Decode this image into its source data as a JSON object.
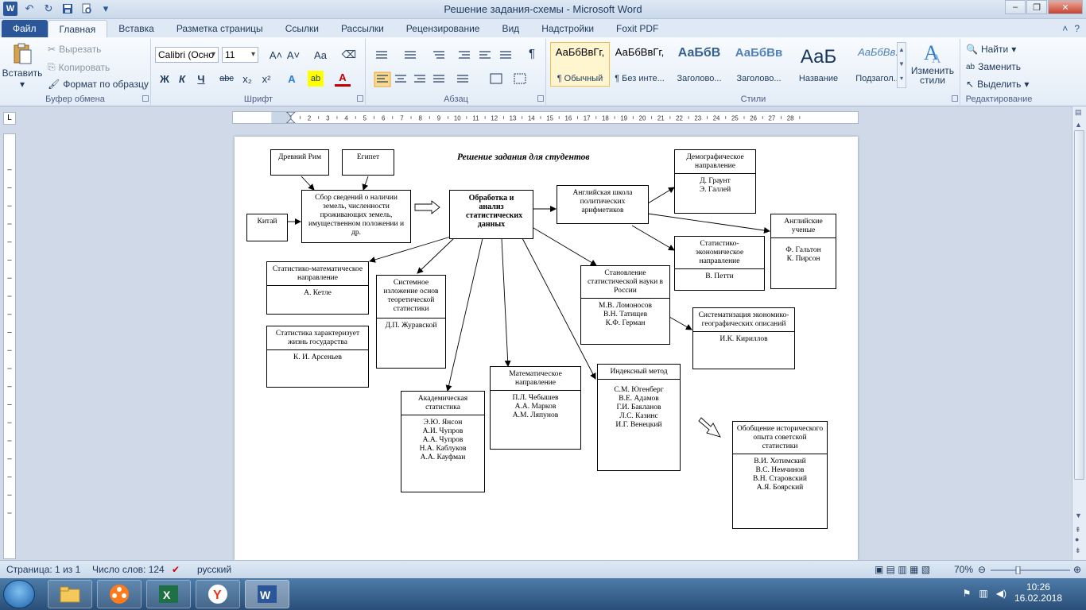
{
  "window": {
    "title": "Решение задания-схемы  -  Microsoft Word",
    "minimize": "–",
    "restore": "❐",
    "close": "✕"
  },
  "qat": {
    "word_icon": "W",
    "undo": "↶",
    "redo": "↻"
  },
  "tabs": [
    "Файл",
    "Главная",
    "Вставка",
    "Разметка страницы",
    "Ссылки",
    "Рассылки",
    "Рецензирование",
    "Вид",
    "Надстройки",
    "Foxit PDF"
  ],
  "ribbon": {
    "clipboard": {
      "paste": "Вставить",
      "cut": "Вырезать",
      "copy": "Копировать",
      "format_painter": "Формат по образцу",
      "label": "Буфер обмена"
    },
    "font": {
      "name": "Calibri (Осно",
      "size": "11",
      "label": "Шрифт",
      "bold": "Ж",
      "italic": "К",
      "underline": "Ч",
      "strike": "abc",
      "sub": "x₂",
      "sup": "x²",
      "grow": "A˄",
      "shrink": "A˅",
      "case": "Aa",
      "clear": "⌫",
      "effects": "A",
      "highlight": "ab",
      "color": "A"
    },
    "paragraph": {
      "label": "Абзац",
      "pilcrow": "¶"
    },
    "styles": {
      "label": "Стили",
      "items": [
        {
          "preview": "АаБбВвГг,",
          "name": "¶ Обычный"
        },
        {
          "preview": "АаБбВвГг,",
          "name": "¶ Без инте..."
        },
        {
          "preview": "АаБбВ",
          "name": "Заголово..."
        },
        {
          "preview": "АаБбВв",
          "name": "Заголово..."
        },
        {
          "preview": "АаБ",
          "name": "Название"
        },
        {
          "preview": "АаБбВв.",
          "name": "Подзагол..."
        }
      ],
      "change": "Изменить стили"
    },
    "editing": {
      "find": "Найти",
      "replace": "Заменить",
      "select": "Выделить",
      "label": "Редактирование"
    }
  },
  "ruler": {
    "corner": "L",
    "marks": [
      "1",
      "2",
      "3",
      "4",
      "5",
      "6",
      "7",
      "8",
      "9",
      "10",
      "11",
      "12",
      "13",
      "14",
      "15",
      "16",
      "17",
      "18",
      "19",
      "20",
      "21",
      "22",
      "23",
      "24",
      "25",
      "26",
      "27",
      "28"
    ]
  },
  "diagram": {
    "title": "Решение задания для студентов",
    "ancient_rome": "Древний Рим",
    "egypt": "Египет",
    "china": "Китай",
    "collection": "Сбор сведений о наличии земель, численности проживающих земель, имущественном положении и др.",
    "processing": "Обработка и анализ статистических данных",
    "english_school": "Английская школа политических арифметиков",
    "demographic_head": "Демографическое направление",
    "demographic_body": [
      "Д. Граунт",
      "Э. Галлей"
    ],
    "english_scientists_head": "Английские ученые",
    "english_scientists_body": [
      "Ф. Гальтон",
      "К. Пирсон"
    ],
    "stat_econ_head": "Статистико-экономическое направление",
    "stat_econ_body": [
      "В. Петти"
    ],
    "stat_math_head": "Статистико-математическое направление",
    "stat_math_body": [
      "А. Кетле"
    ],
    "systematic_head": "Системное изложение основ теоретической статистики",
    "systematic_body": [
      "Д.П. Журавской"
    ],
    "russia_head": "Становление статистической науки в России",
    "russia_body": [
      "М.В. Ломоносов",
      "В.Н. Татищев",
      "К.Ф. Герман"
    ],
    "systematization_head": "Систематизация экономико-географических описаний",
    "systematization_body": [
      "И.К. Кириллов"
    ],
    "stat_life_head": "Статистика характеризует жизнь государства",
    "stat_life_body": [
      "К. И. Арсеньев"
    ],
    "academic_head": "Академическая статистика",
    "academic_body": [
      "Э.Ю. Янсон",
      "А.И. Чупров",
      "А.А. Чупров",
      "Н.А. Каблуков",
      "А.А. Кауфман"
    ],
    "mathematical_head": "Математическое направление",
    "mathematical_body": [
      "П.Л. Чебышев",
      "А.А. Марков",
      "А.М. Ляпунов"
    ],
    "index_head": "Индексный метод",
    "index_body": [
      "С.М. Югенберг",
      "В.Е. Адамов",
      "Г.И. Бакланов",
      "Л.С. Казинс",
      "И.Г. Венецкий"
    ],
    "generalization_head": "Обобщение исторического опыта советской статистики",
    "generalization_body": [
      "В.И. Хотимский",
      "В.С. Немчинов",
      "В.Н. Старовский",
      "А.Я. Боярский"
    ]
  },
  "status": {
    "page": "Страница: 1 из 1",
    "words": "Число слов: 124",
    "language": "русский",
    "zoom": "70%"
  },
  "taskbar": {
    "time": "10:26",
    "date": "16.02.2018"
  },
  "colors": {
    "accent": "#2b579a",
    "ribbon": "#e3ecf7",
    "taskbar": "#2a4f78"
  }
}
